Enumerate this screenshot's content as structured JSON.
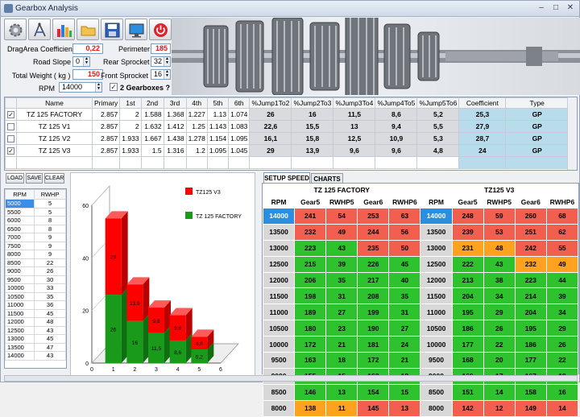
{
  "window": {
    "title": "Gearbox Analysis"
  },
  "toolbar": {
    "icons": [
      "gear-icon",
      "compass-icon",
      "bar-chart-icon",
      "folder-icon",
      "save-icon",
      "monitor-icon",
      "power-icon"
    ]
  },
  "params": {
    "drag_label": "DragArea Coefficient",
    "drag_value": "0,22",
    "perimeter_label": "Perimeter",
    "perimeter_value": "185",
    "slope_label": "Road Slope",
    "slope_value": "0",
    "rear_label": "Rear Sprocket",
    "rear_value": "32",
    "weight_label": "Total Weight ( kg )",
    "weight_value": "150",
    "front_label": "Front Sprocket",
    "front_value": "16",
    "rpm_label": "RPM",
    "rpm_value": "14000",
    "two_gearboxes_label": "2 Gearboxes ?"
  },
  "gearbox_table": {
    "headers": [
      "",
      "Name",
      "Primary",
      "1st",
      "2nd",
      "3rd",
      "4th",
      "5th",
      "6th",
      "%Jump1To2",
      "%Jump2To3",
      "%Jump3To4",
      "%Jump4To5",
      "%Jump5To6",
      "Coefficient",
      "Type"
    ],
    "rows": [
      {
        "checked": true,
        "cells": [
          "TZ 125 FACTORY",
          "2.857",
          "2",
          "1.588",
          "1.368",
          "1.227",
          "1.13",
          "1.074",
          "26",
          "16",
          "11,5",
          "8,6",
          "5,2",
          "25,3",
          "GP"
        ]
      },
      {
        "checked": false,
        "cells": [
          "TZ 125 V1",
          "2.857",
          "2",
          "1.632",
          "1.412",
          "1.25",
          "1.143",
          "1.083",
          "22,6",
          "15,5",
          "13",
          "9,4",
          "5,5",
          "27,9",
          "GP"
        ]
      },
      {
        "checked": false,
        "cells": [
          "TZ 125 V2",
          "2.857",
          "1.933",
          "1.667",
          "1.438",
          "1.278",
          "1.154",
          "1.095",
          "16,1",
          "15,8",
          "12,5",
          "10,9",
          "5,3",
          "28,7",
          "GP"
        ]
      },
      {
        "checked": true,
        "cells": [
          "TZ 125 V3",
          "2.857",
          "1.933",
          "1.5",
          "1.316",
          "1.2",
          "1.095",
          "1.045",
          "29",
          "13,9",
          "9,6",
          "9,6",
          "4,8",
          "24",
          "GP"
        ]
      }
    ]
  },
  "buttons": {
    "load": "LOAD",
    "save": "SAVE",
    "clear": "CLEAR"
  },
  "rpm_table": {
    "headers": [
      "RPM",
      "RWHP"
    ],
    "rows": [
      [
        "5000",
        "5"
      ],
      [
        "5500",
        "5"
      ],
      [
        "6000",
        "8"
      ],
      [
        "6500",
        "8"
      ],
      [
        "7000",
        "9"
      ],
      [
        "7500",
        "9"
      ],
      [
        "8000",
        "9"
      ],
      [
        "8500",
        "22"
      ],
      [
        "9000",
        "26"
      ],
      [
        "9500",
        "30"
      ],
      [
        "10000",
        "33"
      ],
      [
        "10500",
        "35"
      ],
      [
        "11000",
        "36"
      ],
      [
        "11500",
        "45"
      ],
      [
        "12000",
        "48"
      ],
      [
        "12500",
        "43"
      ],
      [
        "13000",
        "45"
      ],
      [
        "13500",
        "47"
      ],
      [
        "14000",
        "43"
      ]
    ]
  },
  "chart_data": {
    "type": "bar",
    "stacked": true,
    "x": [
      1,
      2,
      3,
      4,
      5
    ],
    "series": [
      {
        "name": "TZ125 V3",
        "color": "#ff0000",
        "values": [
          29,
          13.9,
          9.6,
          9.6,
          4.8
        ]
      },
      {
        "name": "TZ 125 FACTORY",
        "color": "#1a9a1a",
        "values": [
          26,
          16,
          11.5,
          8.6,
          5.2
        ]
      }
    ],
    "labels_top": [
      "29",
      "13,9",
      "9,6",
      "9,6",
      "4,8"
    ],
    "labels_bottom": [
      "26",
      "16",
      "11,5",
      "8,6",
      "5,2"
    ],
    "xticks": [
      "0",
      "1",
      "2",
      "3",
      "4",
      "5",
      "6"
    ],
    "yticks": [
      "0",
      "20",
      "40",
      "60"
    ],
    "ylim": [
      0,
      60
    ],
    "xlim": [
      0,
      6
    ],
    "legend": "top-right"
  },
  "tabs": {
    "setup_speed": "SETUP SPEED",
    "charts": "CHARTS"
  },
  "speed_table": {
    "group_left": "TZ 125 FACTORY",
    "group_right": "TZ125 V3",
    "headers": [
      "RPM",
      "Gear5",
      "RWHP5",
      "Gear6",
      "RWHP6",
      "RPM",
      "Gear5",
      "RWHP5",
      "Gear6",
      "RWHP6"
    ],
    "rows": [
      [
        "14000",
        "241",
        "54",
        "253",
        "63",
        "14000",
        "248",
        "59",
        "260",
        "68"
      ],
      [
        "13500",
        "232",
        "49",
        "244",
        "56",
        "13500",
        "239",
        "53",
        "251",
        "62"
      ],
      [
        "13000",
        "223",
        "43",
        "235",
        "50",
        "13000",
        "231",
        "48",
        "242",
        "55"
      ],
      [
        "12500",
        "215",
        "39",
        "226",
        "45",
        "12500",
        "222",
        "43",
        "232",
        "49"
      ],
      [
        "12000",
        "206",
        "35",
        "217",
        "40",
        "12000",
        "213",
        "38",
        "223",
        "44"
      ],
      [
        "11500",
        "198",
        "31",
        "208",
        "35",
        "11500",
        "204",
        "34",
        "214",
        "39"
      ],
      [
        "11000",
        "189",
        "27",
        "199",
        "31",
        "11000",
        "195",
        "29",
        "204",
        "34"
      ],
      [
        "10500",
        "180",
        "23",
        "190",
        "27",
        "10500",
        "186",
        "26",
        "195",
        "29"
      ],
      [
        "10000",
        "172",
        "21",
        "181",
        "24",
        "10000",
        "177",
        "22",
        "186",
        "26"
      ],
      [
        "9500",
        "163",
        "18",
        "172",
        "21",
        "9500",
        "168",
        "20",
        "177",
        "22"
      ],
      [
        "9000",
        "155",
        "15",
        "163",
        "18",
        "9000",
        "160",
        "17",
        "167",
        "19"
      ],
      [
        "8500",
        "146",
        "13",
        "154",
        "15",
        "8500",
        "151",
        "14",
        "158",
        "16"
      ],
      [
        "8000",
        "138",
        "11",
        "145",
        "13",
        "8000",
        "142",
        "12",
        "149",
        "14"
      ]
    ],
    "colors": {
      "red": "#f25f4f",
      "green": "#2ec22e",
      "orange": "#ffa21f",
      "gray": "#d8d8d8",
      "blue": "#2a8fe0"
    }
  }
}
